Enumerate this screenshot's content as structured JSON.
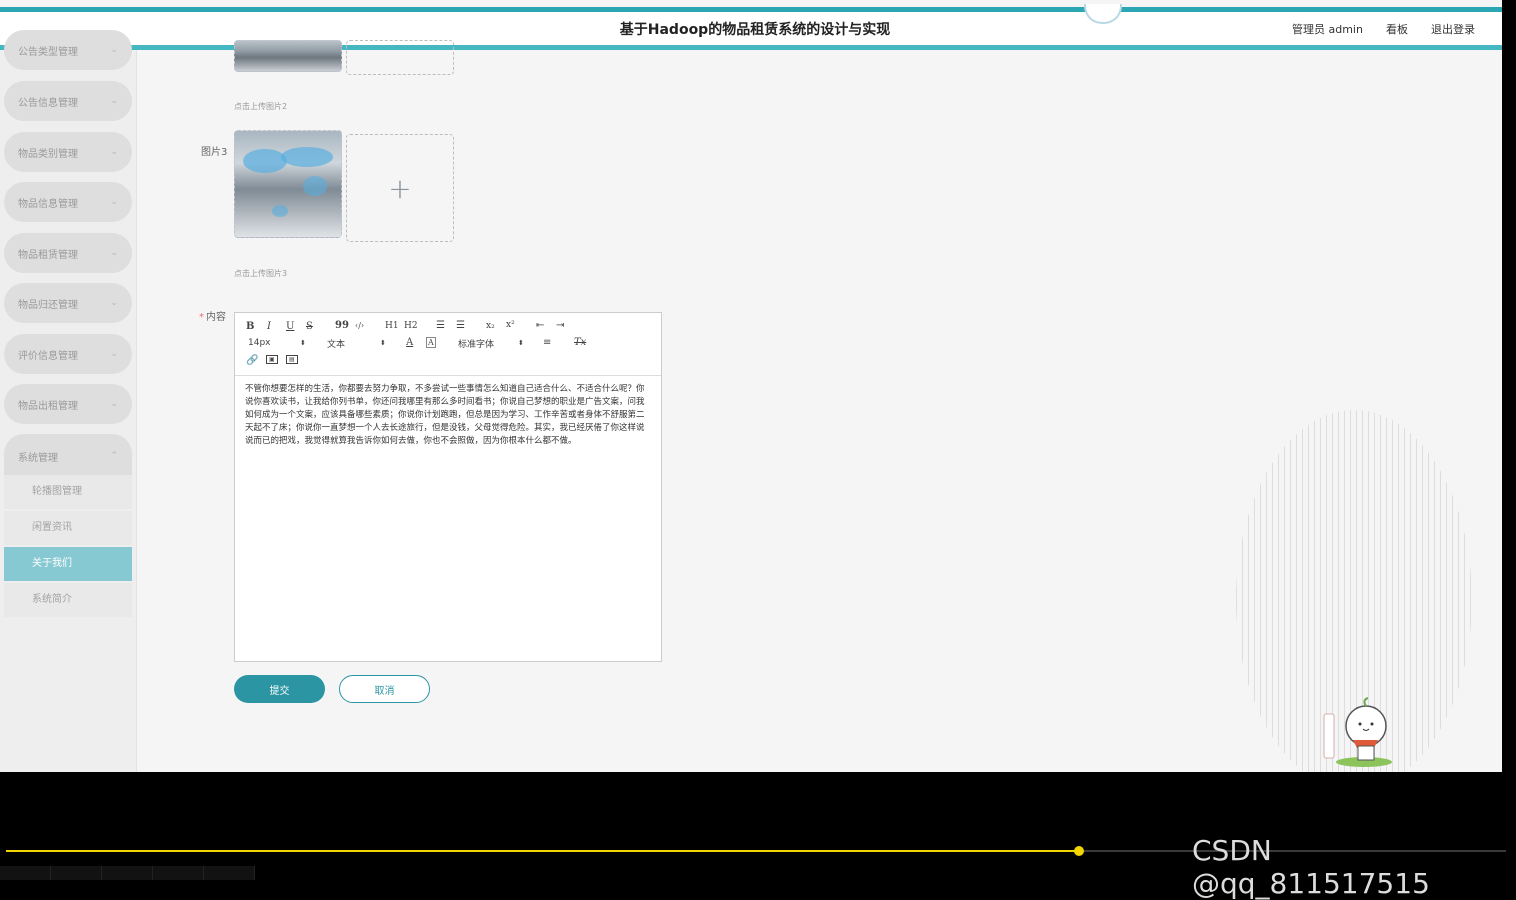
{
  "header": {
    "title": "基于Hadoop的物品租赁系统的设计与实现",
    "user_label": "管理员 admin",
    "dashboard_link": "看板",
    "logout_link": "退出登录"
  },
  "sidebar": {
    "items": [
      {
        "label": "公告类型管理"
      },
      {
        "label": "公告信息管理"
      },
      {
        "label": "物品类别管理"
      },
      {
        "label": "物品信息管理"
      },
      {
        "label": "物品租赁管理"
      },
      {
        "label": "物品归还管理"
      },
      {
        "label": "评价信息管理"
      },
      {
        "label": "物品出租管理"
      },
      {
        "label": "系统管理"
      }
    ],
    "system_children": [
      {
        "label": "轮播图管理"
      },
      {
        "label": "闲置资讯"
      },
      {
        "label": "关于我们",
        "active": true
      },
      {
        "label": "系统简介"
      }
    ]
  },
  "form": {
    "picture2_hint": "点击上传图片2",
    "picture3_label": "图片3",
    "picture3_hint": "点击上传图片3",
    "content_label": "内容",
    "upload_plus": "+",
    "submit_label": "提交",
    "cancel_label": "取消"
  },
  "editor": {
    "toolbar": {
      "bold": "B",
      "italic": "I",
      "underline": "U",
      "strike": "S",
      "quote": "99",
      "code": "‹/›",
      "h1": "H1",
      "h2": "H2",
      "subscript": "x₂",
      "superscript": "x²",
      "size_value": "14px",
      "header_value": "文本",
      "font_value": "标准字体",
      "clean": "Tx"
    },
    "content": "不管你想要怎样的生活，你都要去努力争取，不多尝试一些事情怎么知道自己适合什么、不适合什么呢？你说你喜欢读书，让我给你列书单，你还问我哪里有那么多时间看书；你说自己梦想的职业是广告文案，问我如何成为一个文案，应该具备哪些素质；你说你计划跑跑，但总是因为学习、工作辛苦或者身体不舒服第二天起不了床；你说你一直梦想一个人去长途旅行，但是没钱，父母觉得危险。其实，我已经厌倦了你这样说说而已的把戏，我觉得就算我告诉你如何去做，你也不会照做，因为你根本什么都不做。"
  },
  "video": {
    "watermark": "CSDN @qq_811517515",
    "progress": 0.715
  },
  "colors": {
    "accent": "#2b95a4",
    "active_menu": "#86c9d2",
    "progress": "#f2d500"
  }
}
